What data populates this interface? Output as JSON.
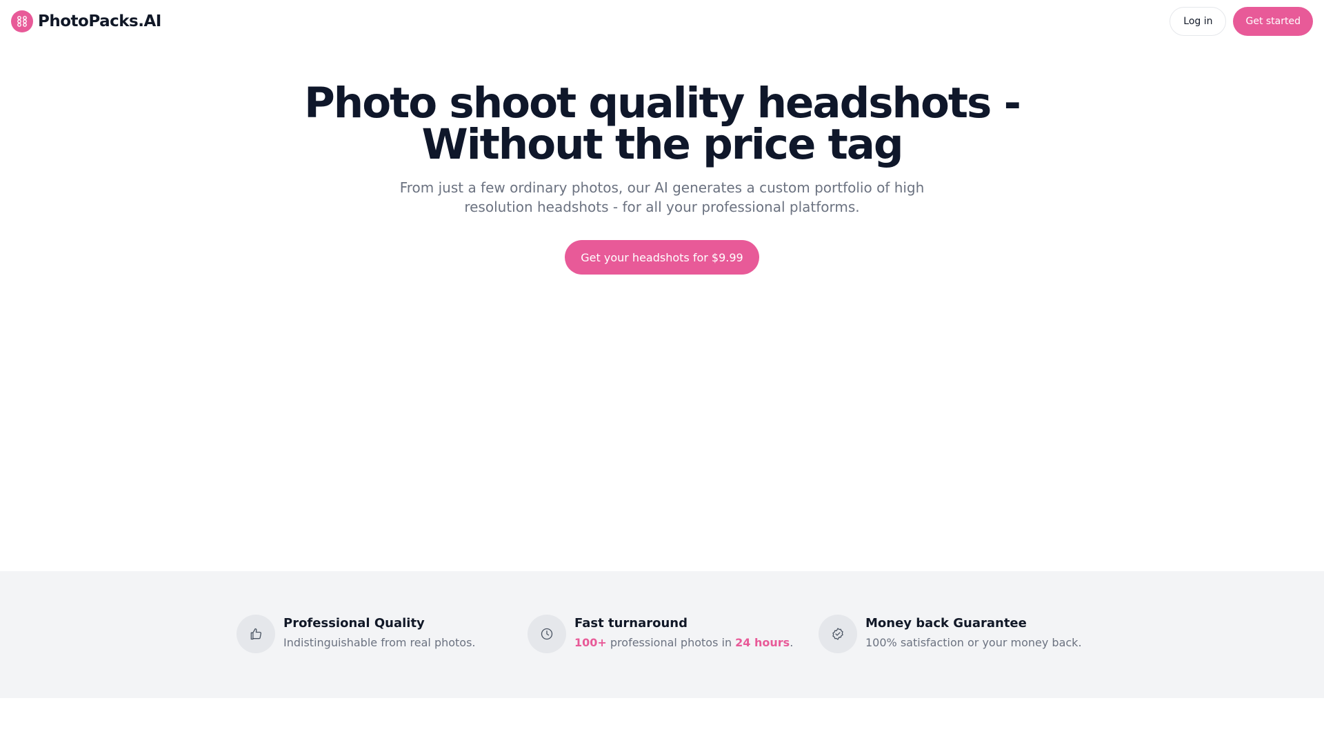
{
  "header": {
    "brand": "PhotoPacks.AI",
    "logo_icon": "photo-grid-icon",
    "login_label": "Log in",
    "get_started_label": "Get started"
  },
  "hero": {
    "title_line1": "Photo shoot quality headshots -",
    "title_line2": "Without the price tag",
    "subtitle": "From just a few ordinary photos, our AI generates a custom portfolio of high resolution headshots - for all your professional platforms.",
    "cta_label": "Get your headshots for $9.99"
  },
  "features": [
    {
      "icon": "thumbs-up-icon",
      "title": "Professional Quality",
      "desc": "Indistinguishable from real photos."
    },
    {
      "icon": "clock-icon",
      "title": "Fast turnaround",
      "desc_count": "100+",
      "desc_mid": " professional photos in ",
      "desc_time": "24 hours",
      "desc_end": "."
    },
    {
      "icon": "badge-check-icon",
      "title": "Money back Guarantee",
      "desc": "100% satisfaction or your money back."
    }
  ],
  "colors": {
    "accent": "#e85a98",
    "heading": "#0f172a",
    "muted": "#6b7280",
    "feature_band": "#f3f4f6"
  }
}
